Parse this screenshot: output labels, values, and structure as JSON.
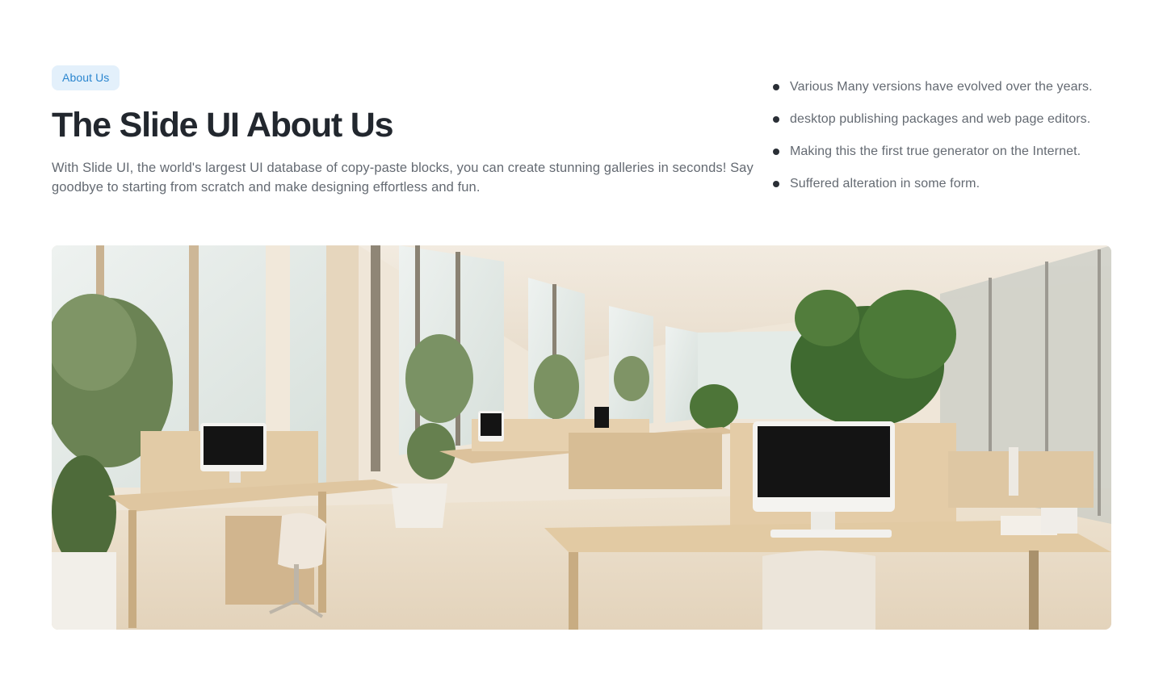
{
  "about": {
    "badge_label": "About Us",
    "title": "The Slide UI About Us",
    "description": "With Slide UI, the world's largest UI database of copy-paste blocks, you can create stunning galleries in seconds! Say goodbye to starting from scratch and make designing effortless and fun.",
    "points": [
      "Various Many versions have evolved over the years.",
      "desktop publishing packages and web page editors.",
      "Making this the first true generator on the Internet.",
      "Suffered alteration in some form."
    ]
  },
  "hero_image": {
    "subject": "office-interior-photo",
    "colors": {
      "wall": "#efe6d8",
      "wood": "#d9bf98",
      "floor": "#e9dcc7",
      "window": "#dfe6e6",
      "plant": "#5d7a44",
      "screen": "#141414"
    }
  }
}
